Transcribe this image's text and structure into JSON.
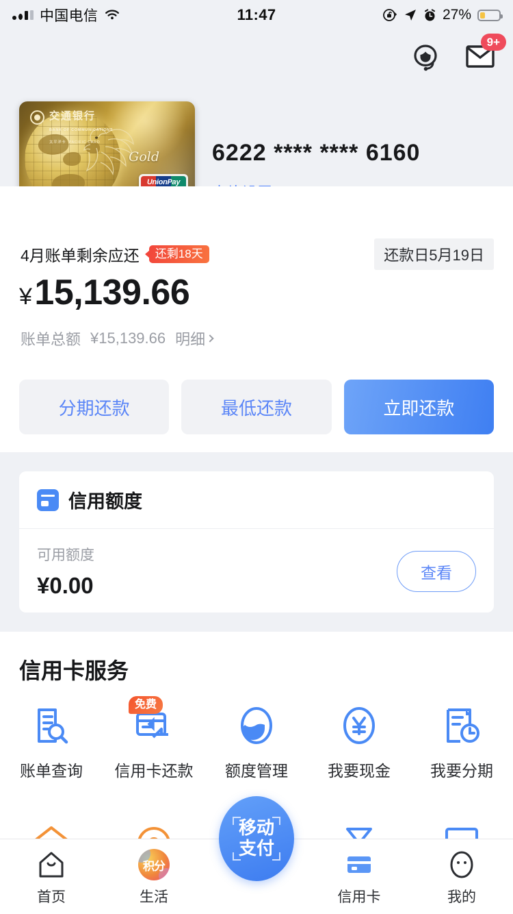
{
  "status_bar": {
    "carrier": "中国电信",
    "time": "11:47",
    "battery_percent": "27%",
    "icons": [
      "signal-icon",
      "wifi-icon",
      "rotation-lock-icon",
      "location-arrow-icon",
      "alarm-icon",
      "battery-icon"
    ]
  },
  "header": {
    "service_icon": "customer-service-headset-icon",
    "mail_icon": "mail-envelope-icon",
    "mail_badge": "9+",
    "card_number": "6222 **** **** 6160",
    "card_settings_label": "卡片设置",
    "card_art": {
      "bank_name_cn": "交通银行",
      "bank_name_en": "BANK OF COMMUNICATIONS",
      "card_series_cn": "太平洋卡",
      "card_series_en": "PACIFIC CARD",
      "tier": "Gold",
      "network_en": "UnionPay",
      "network_cn": "银联"
    }
  },
  "bill": {
    "label": "4月账单剩余应还",
    "days_badge": "还剩18天",
    "due_date": "还款日5月19日",
    "currency": "¥",
    "amount": "15,139.66",
    "total_label": "账单总额",
    "total_amount": "¥15,139.66",
    "detail_label": "明细",
    "buttons": [
      {
        "label": "分期还款",
        "style": "secondary"
      },
      {
        "label": "最低还款",
        "style": "secondary"
      },
      {
        "label": "立即还款",
        "style": "primary"
      }
    ]
  },
  "credit_limit": {
    "title": "信用额度",
    "icon": "credit-card-icon",
    "available_label": "可用额度",
    "available_amount": "¥0.00",
    "view_button": "查看"
  },
  "services": {
    "title": "信用卡服务",
    "items": [
      {
        "label": "账单查询",
        "icon": "bill-search-icon",
        "badge": ""
      },
      {
        "label": "信用卡还款",
        "icon": "card-repay-icon",
        "badge": "免费"
      },
      {
        "label": "额度管理",
        "icon": "limit-manage-icon",
        "badge": ""
      },
      {
        "label": "我要现金",
        "icon": "cash-yen-icon",
        "badge": ""
      },
      {
        "label": "我要分期",
        "icon": "installment-clock-icon",
        "badge": ""
      }
    ],
    "row2_icons": [
      "house-orange-icon",
      "circle-orange-icon",
      "scan-blue-icon",
      "bowtie-blue-icon",
      "frame-blue-icon"
    ]
  },
  "tabbar": {
    "items": [
      {
        "label": "首页",
        "icon": "home-icon",
        "active": false
      },
      {
        "label": "生活",
        "icon": "points-jifen-icon",
        "active": false
      },
      {
        "label": "信用卡",
        "icon": "credit-card-tab-icon",
        "active": true
      },
      {
        "label": "我的",
        "icon": "profile-face-icon",
        "active": false
      }
    ],
    "fab": {
      "line1": "移动",
      "line2": "支付",
      "icon": "mobile-pay-scan-icon"
    }
  },
  "colors": {
    "accent_blue": "#4a8af5",
    "primary_gradient_from": "#6ea4f8",
    "primary_gradient_to": "#3f7ff2",
    "badge_red": "#f2463b",
    "page_gray": "#eff1f5",
    "text_dark": "#17181a",
    "text_muted": "#9a9da4"
  }
}
